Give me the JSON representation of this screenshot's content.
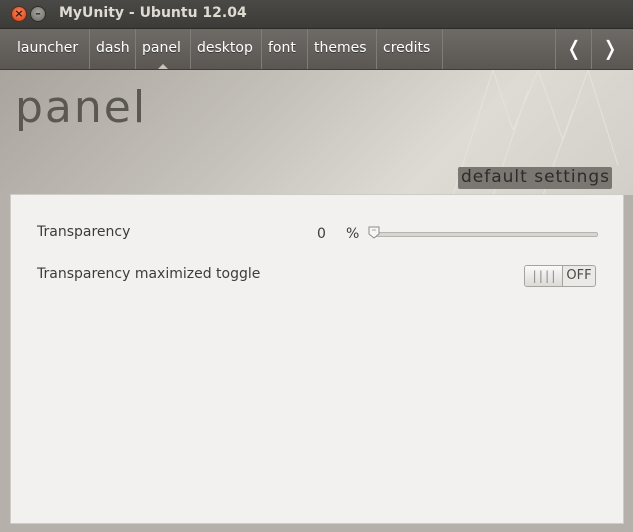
{
  "window": {
    "title": "MyUnity - Ubuntu 12.04",
    "close_glyph": "×",
    "minimize_glyph": "–"
  },
  "nav": {
    "tabs": [
      {
        "label": "launcher"
      },
      {
        "label": "dash"
      },
      {
        "label": "panel",
        "active": true
      },
      {
        "label": "desktop"
      },
      {
        "label": "font"
      },
      {
        "label": "themes"
      },
      {
        "label": "credits"
      }
    ],
    "prev_glyph": "❬",
    "next_glyph": "❭"
  },
  "header": {
    "page_title": "panel",
    "default_settings_label": "default settings"
  },
  "settings": {
    "transparency": {
      "label": "Transparency",
      "value": "0",
      "unit": "%",
      "slider_fraction": 0
    },
    "maximized_toggle": {
      "label": "Transparency maximized toggle",
      "grip": "||||",
      "state_label": "OFF"
    }
  },
  "colors": {
    "titlebar": "#3c3b37",
    "close_button": "#e0542a",
    "navbar": "#5f5c58",
    "content_bg": "#f2f1f0"
  }
}
